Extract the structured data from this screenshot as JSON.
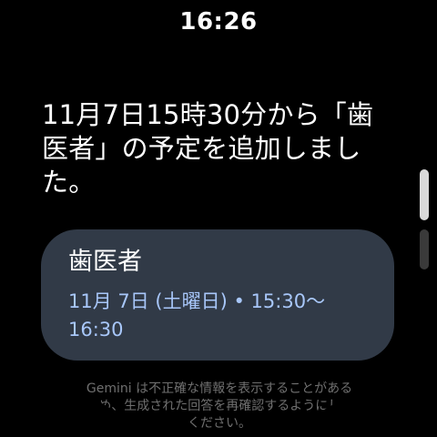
{
  "status_bar": {
    "time": "16:26"
  },
  "assistant": {
    "message": "11月7日15時30分から「歯医者」の予定を追加しました。"
  },
  "event_card": {
    "title": "歯医者",
    "datetime": "11月 7日 (土曜日) • 15:30～16:30"
  },
  "disclaimer": {
    "text": "Gemini は不正確な情報を表示することがあるため、生成された回答を再確認するようにしてください。"
  }
}
